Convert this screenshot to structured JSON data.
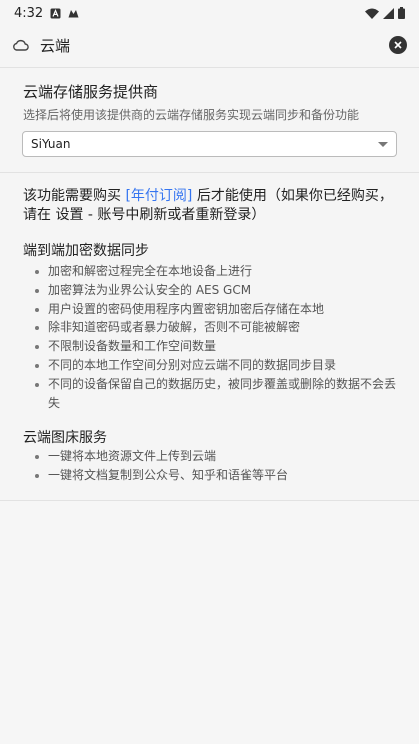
{
  "status_bar": {
    "time": "4:32"
  },
  "header": {
    "title": "云端"
  },
  "provider": {
    "title": "云端存储服务提供商",
    "description": "选择后将使用该提供商的云端存储服务实现云端同步和备份功能",
    "selected": "SiYuan"
  },
  "notice": {
    "prefix": "该功能需要购买 ",
    "link": "[年付订阅]",
    "suffix": " 后才能使用（如果你已经购买，请在 设置 - 账号中刷新或者重新登录）"
  },
  "e2e": {
    "title": "端到端加密数据同步",
    "items": [
      "加密和解密过程完全在本地设备上进行",
      "加密算法为业界公认安全的 AES GCM",
      "用户设置的密码使用程序内置密钥加密后存储在本地",
      "除非知道密码或者暴力破解，否则不可能被解密",
      "不限制设备数量和工作空间数量",
      "不同的本地工作空间分别对应云端不同的数据同步目录",
      "不同的设备保留自己的数据历史，被同步覆盖或删除的数据不会丢失"
    ]
  },
  "image_hosting": {
    "title": "云端图床服务",
    "items": [
      "一键将本地资源文件上传到云端",
      "一键将文档复制到公众号、知乎和语雀等平台"
    ]
  }
}
